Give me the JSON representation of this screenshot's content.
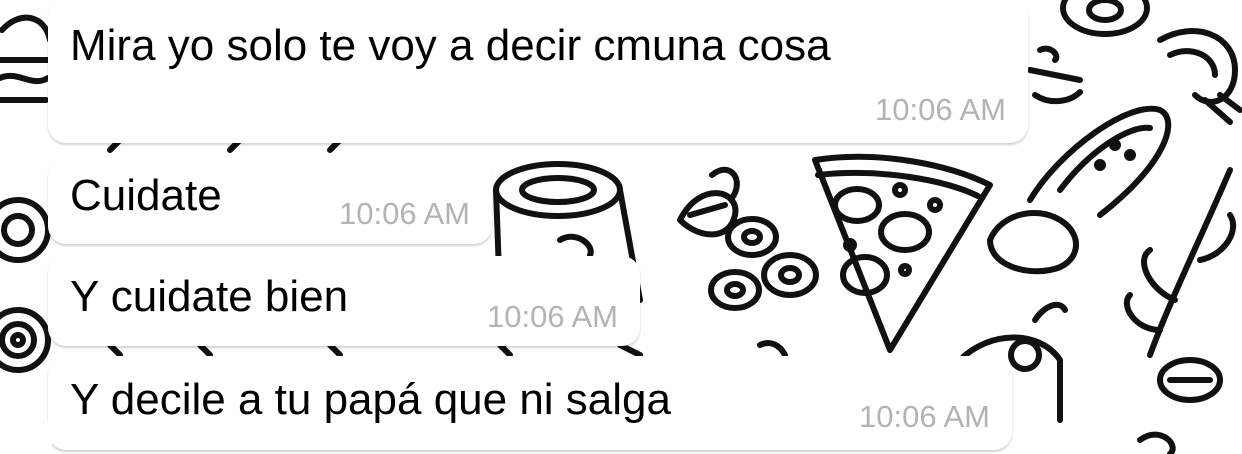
{
  "chat": {
    "messages": [
      {
        "text": "Mira yo solo te voy a decir cmuna cosa",
        "time": "10:06 AM"
      },
      {
        "text": "Cuidate",
        "time": "10:06 AM"
      },
      {
        "text": "Y cuidate bien",
        "time": "10:06 AM"
      },
      {
        "text": "Y decile a tu papá que ni salga",
        "time": "10:06 AM"
      }
    ]
  },
  "colors": {
    "bubble": "#ffffff",
    "timestamp": "#b3b3b3",
    "wallpaper_ink": "#111111"
  },
  "icons": [
    "food-doodle-wallpaper"
  ]
}
